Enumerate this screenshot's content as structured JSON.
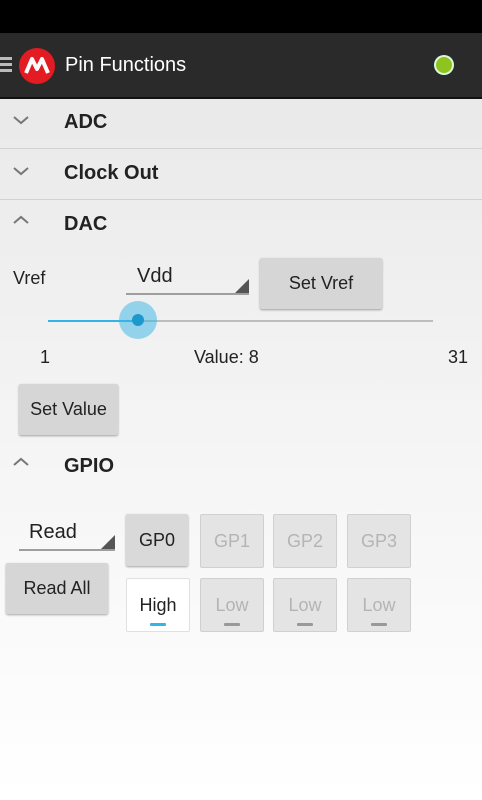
{
  "app": {
    "title": "Pin Functions"
  },
  "colors": {
    "status_dot": "#8fc31f",
    "accent": "#33b5e5",
    "logo": "#e31b23"
  },
  "sections": {
    "adc": {
      "label": "ADC",
      "expanded": false
    },
    "clock_out": {
      "label": "Clock Out",
      "expanded": false
    },
    "dac": {
      "label": "DAC",
      "expanded": true
    },
    "gpio": {
      "label": "GPIO",
      "expanded": true
    }
  },
  "dac": {
    "vref_label": "Vref",
    "vref_value": "Vdd",
    "set_vref_label": "Set Vref",
    "slider": {
      "min": 1,
      "max": 31,
      "value": 8
    },
    "min_label": "1",
    "max_label": "31",
    "value_text": "Value: 8",
    "set_value_label": "Set Value"
  },
  "gpio": {
    "mode_value": "Read",
    "read_all_label": "Read All",
    "pins": [
      {
        "label": "GP0",
        "enabled": true,
        "state": "High"
      },
      {
        "label": "GP1",
        "enabled": false,
        "state": "Low"
      },
      {
        "label": "GP2",
        "enabled": false,
        "state": "Low"
      },
      {
        "label": "GP3",
        "enabled": false,
        "state": "Low"
      }
    ]
  }
}
